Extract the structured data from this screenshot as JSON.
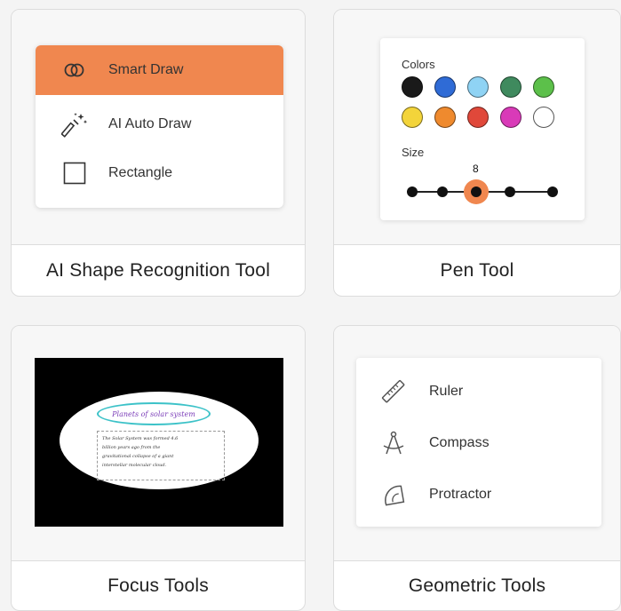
{
  "cards": {
    "shape": {
      "caption": "AI Shape Recognition Tool",
      "menu": [
        {
          "label": "Smart Draw",
          "icon": "smart-draw-icon",
          "active": true
        },
        {
          "label": "AI Auto Draw",
          "icon": "magic-wand-icon",
          "active": false
        },
        {
          "label": "Rectangle",
          "icon": "rectangle-icon",
          "active": false
        }
      ]
    },
    "pen": {
      "caption": "Pen Tool",
      "colors_label": "Colors",
      "size_label": "Size",
      "colors": [
        "#1a1a1a",
        "#2f6bd6",
        "#8fd3f4",
        "#3f8a5e",
        "#5cc04a",
        "#f3d43a",
        "#ef8a2e",
        "#e0483a",
        "#d93ab8",
        "#ffffff"
      ],
      "size_value": "8",
      "size_options": 5,
      "size_selected_index": 2
    },
    "focus": {
      "caption": "Focus Tools",
      "note_title": "Planets of solar system",
      "note_lines": [
        "The Solar System was formed 4.6",
        "billion years ago from the",
        "gravitational collapse of a giant",
        "interstellar molecular cloud."
      ]
    },
    "geo": {
      "caption": "Geometric Tools",
      "items": [
        {
          "label": "Ruler",
          "icon": "ruler-icon"
        },
        {
          "label": "Compass",
          "icon": "compass-icon"
        },
        {
          "label": "Protractor",
          "icon": "protractor-icon"
        }
      ]
    }
  },
  "accent_color": "#f0874f"
}
